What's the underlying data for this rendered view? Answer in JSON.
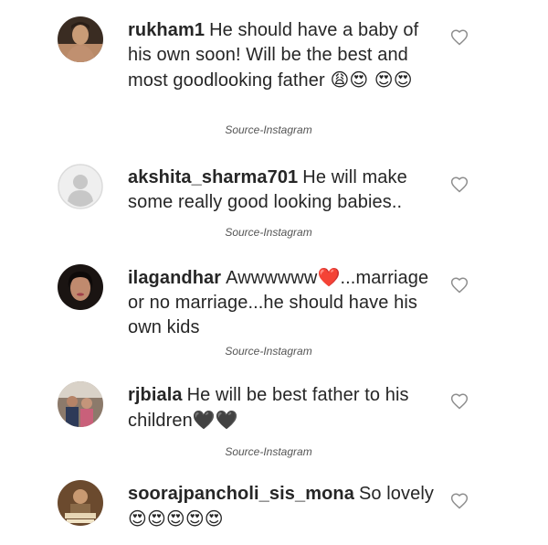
{
  "comments": [
    {
      "username": "rukham1",
      "text": "He should have a baby of his own soon! Will be the best and most goodlooking father",
      "emoji": "😩😍 😍😍",
      "avatar_icon": "man-shirtless-avatar",
      "source": "Source-Instagram"
    },
    {
      "username": "akshita_sharma701",
      "text": "He will make some really good looking babies..",
      "emoji": "",
      "avatar_icon": "default-user-avatar",
      "source": "Source-Instagram"
    },
    {
      "username": "ilagandhar",
      "text": "Awwwwww❤️...marriage or no marriage...he should have his own kids",
      "emoji": "",
      "avatar_icon": "woman-portrait-avatar",
      "source": "Source-Instagram"
    },
    {
      "username": "rjbiala",
      "text": "He will be best father to his children",
      "emoji": "🖤🖤",
      "avatar_icon": "group-photo-avatar",
      "source": "Source-Instagram"
    },
    {
      "username": "soorajpancholi_sis_mona",
      "text": "So lovely",
      "emoji": "😍😍😍😍😍",
      "avatar_icon": "movie-poster-avatar",
      "source": ""
    }
  ],
  "colors": {
    "text": "#262626",
    "source": "#555555",
    "heart_outline": "#8e8e8e",
    "default_avatar_bg": "#dbdbdb"
  }
}
